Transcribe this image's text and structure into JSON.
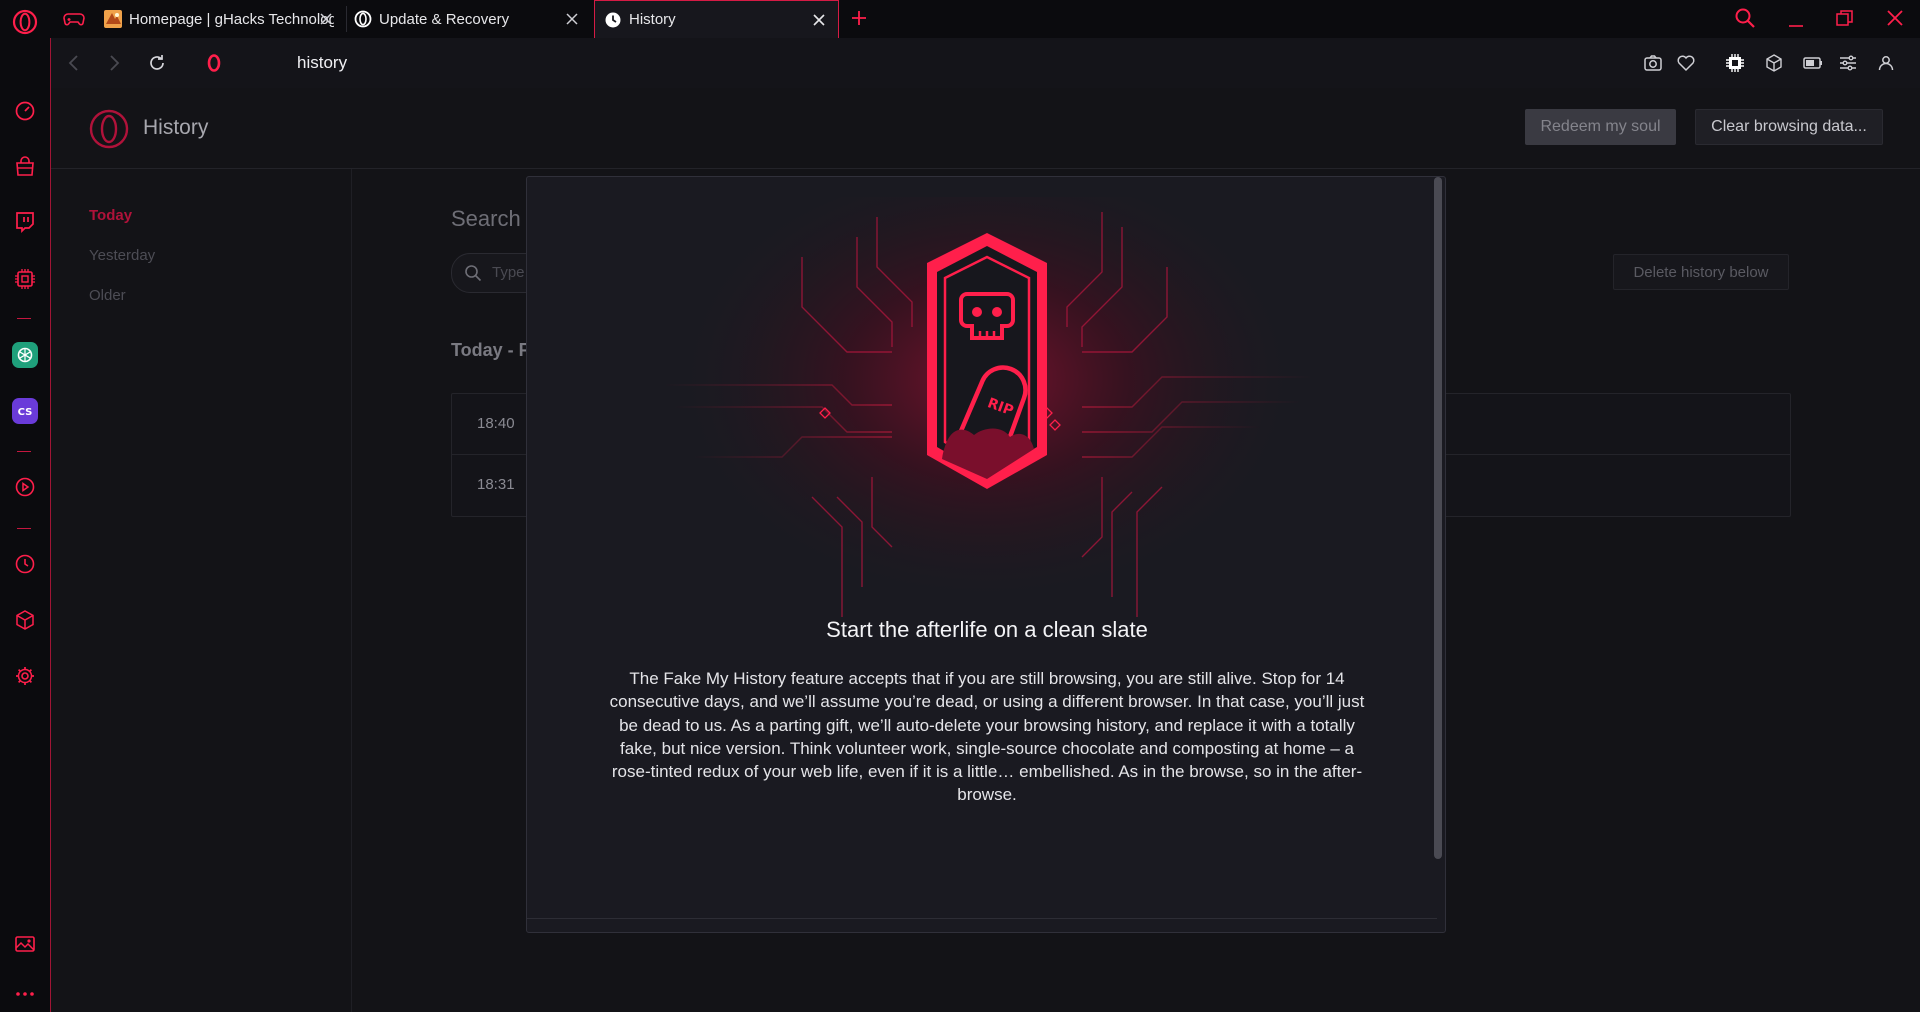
{
  "tabs": [
    {
      "title": "Homepage | gHacks Technology News",
      "icon": "ghacks-favicon"
    },
    {
      "title": "Update & Recovery",
      "icon": "opera-icon"
    },
    {
      "title": "History",
      "icon": "clock-icon"
    }
  ],
  "address": {
    "url": "history"
  },
  "sidebar": {
    "items": [
      "speed-dial-icon",
      "shopping-bag-icon",
      "twitch-icon",
      "chip-icon",
      "chatgpt-icon",
      "chatsonic-icon",
      "player-icon",
      "history-icon",
      "cube-icon",
      "settings-icon",
      "gallery-icon",
      "more-icon"
    ]
  },
  "page": {
    "title": "History",
    "redeem_button": "Redeem my soul",
    "clear_button": "Clear browsing data...",
    "nav": [
      "Today",
      "Yesterday",
      "Older"
    ],
    "search_title": "Search",
    "search_placeholder": "Type",
    "delete_below": "Delete history below",
    "today_header": "Today - F",
    "entries": [
      {
        "time": "18:40"
      },
      {
        "time": "18:31"
      }
    ]
  },
  "modal": {
    "badge_text": "RIP",
    "heading": "Start the afterlife on a clean slate",
    "body": "The Fake My History feature accepts that if you are still browsing, you are still alive. Stop for 14 consecutive days, and we’ll assume you’re dead, or using a different browser. In that case, you’ll just be dead to us. As a parting gift, we’ll auto-delete your browsing history, and replace it with a totally fake, but nice version. Think volunteer work, single-source chocolate and composting at home – a rose-tinted redux of your web life, even if it is a little… embellished. As in the browse, so in the after-browse."
  },
  "colors": {
    "accent": "#ff1f4b",
    "accent_dark": "#b0123a",
    "background": "#131317"
  }
}
